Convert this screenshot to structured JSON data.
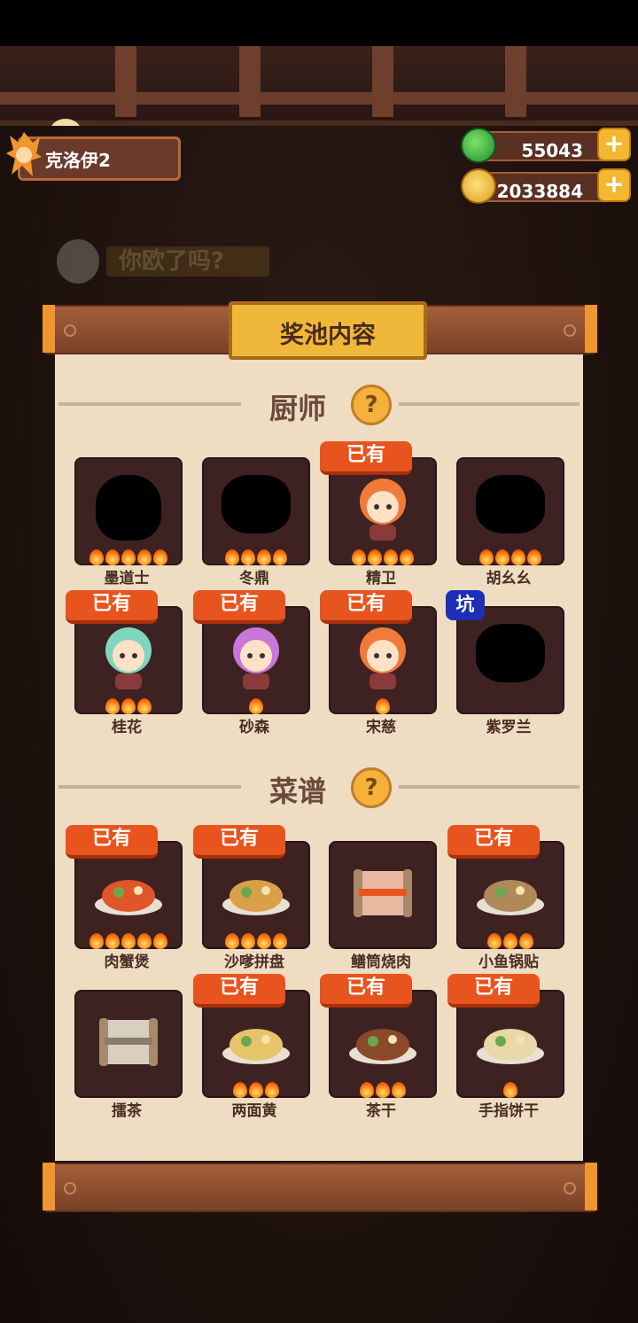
{
  "header": {
    "player_name": "克洛伊2",
    "jade_value": "55043",
    "coin_value": "2033884",
    "plus_label": "+"
  },
  "background_banner": {
    "text": "你欧了吗?"
  },
  "panel": {
    "title": "奖池内容",
    "help_label": "?",
    "chefs_section": "厨师",
    "recipes_section": "菜谱",
    "owned_label": "已有",
    "hole_label": "坑"
  },
  "chefs": [
    {
      "name": "墨道士",
      "stars": 5,
      "owned": false,
      "silhouette": true
    },
    {
      "name": "冬鼎",
      "stars": 4,
      "owned": false,
      "silhouette": true
    },
    {
      "name": "精卫",
      "stars": 4,
      "owned": true,
      "silhouette": false
    },
    {
      "name": "胡幺幺",
      "stars": 4,
      "owned": false,
      "silhouette": true
    },
    {
      "name": "桂花",
      "stars": 3,
      "owned": true,
      "silhouette": false
    },
    {
      "name": "砂森",
      "stars": 1,
      "owned": true,
      "silhouette": false
    },
    {
      "name": "宋慈",
      "stars": 1,
      "owned": true,
      "silhouette": false
    },
    {
      "name": "紫罗兰",
      "stars": 0,
      "owned": false,
      "silhouette": true,
      "badge": "坑"
    }
  ],
  "recipes": [
    {
      "name": "肉蟹煲",
      "stars": 5,
      "owned": true
    },
    {
      "name": "沙嗲拼盘",
      "stars": 4,
      "owned": true
    },
    {
      "name": "鳝筒烧肉",
      "stars": 0,
      "owned": false
    },
    {
      "name": "小鱼锅贴",
      "stars": 3,
      "owned": true
    },
    {
      "name": "擂茶",
      "stars": 0,
      "owned": false
    },
    {
      "name": "两面黄",
      "stars": 3,
      "owned": true
    },
    {
      "name": "茶干",
      "stars": 3,
      "owned": true
    },
    {
      "name": "手指饼干",
      "stars": 1,
      "owned": true
    }
  ],
  "colors": {
    "owned_badge": "#e8541d",
    "hole_badge": "#1c2fb6",
    "card_bg": "#3e2222",
    "parchment": "#eedcc3",
    "title_plate": "#f0b83a"
  }
}
